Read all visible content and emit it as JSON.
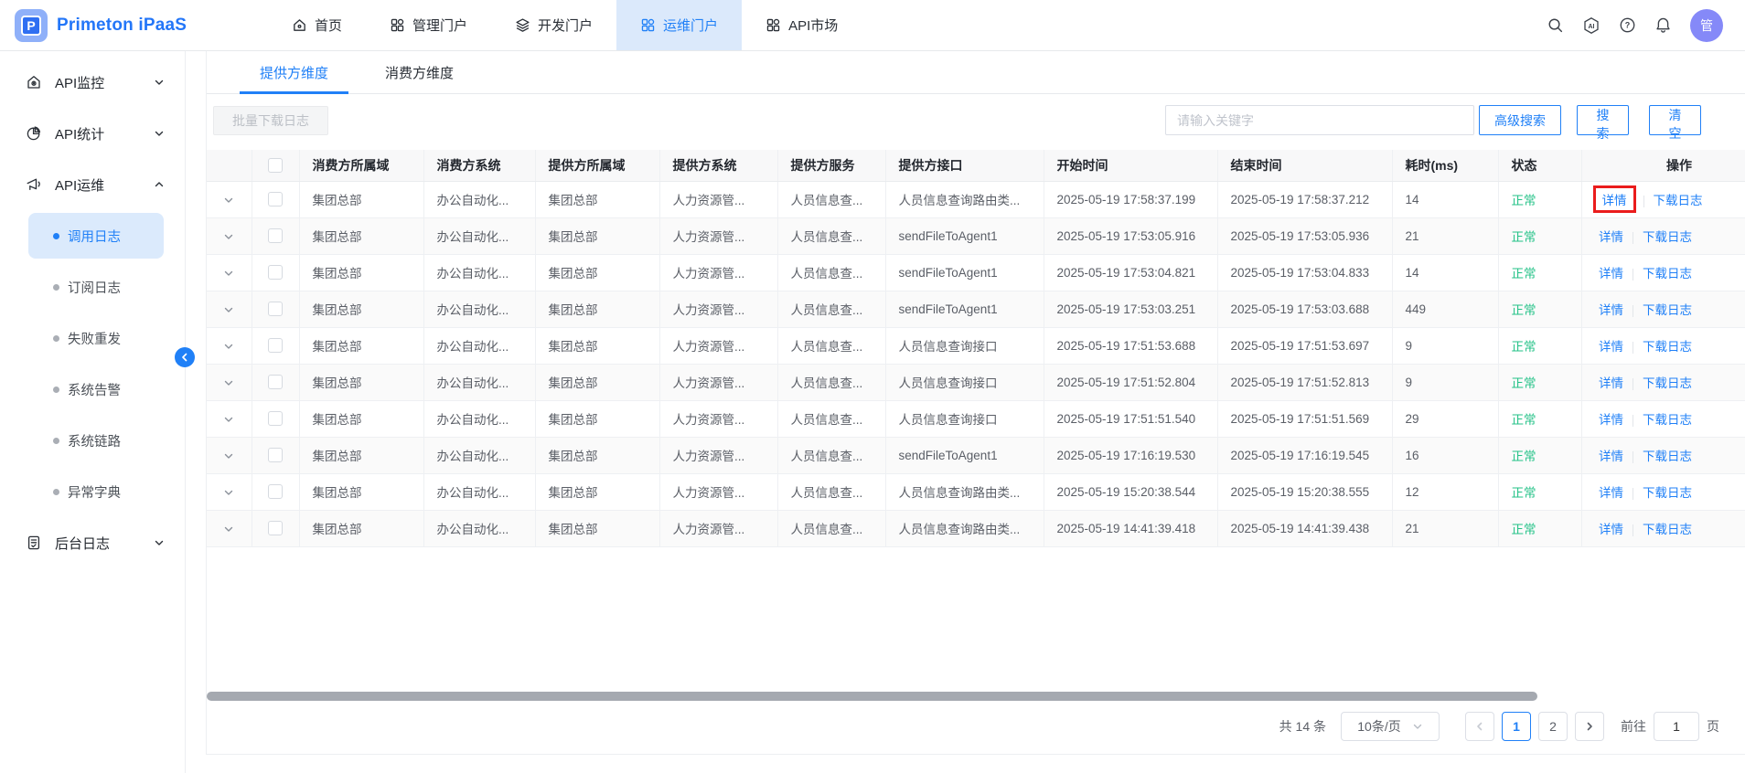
{
  "topbar": {
    "brand": "Primeton iPaaS",
    "logo_letter": "P",
    "nav": [
      {
        "id": "home",
        "label": "首页",
        "icon": "home-icon",
        "active": false
      },
      {
        "id": "admin-portal",
        "label": "管理门户",
        "icon": "grid-icon",
        "active": false
      },
      {
        "id": "dev-portal",
        "label": "开发门户",
        "icon": "layers-icon",
        "active": false
      },
      {
        "id": "ops-portal",
        "label": "运维门户",
        "icon": "grid-icon",
        "active": true
      },
      {
        "id": "api-market",
        "label": "API市场",
        "icon": "grid-icon",
        "active": false
      }
    ],
    "actions": [
      {
        "id": "search",
        "icon": "search-icon"
      },
      {
        "id": "ai-assistant",
        "icon": "ai-icon"
      },
      {
        "id": "help",
        "icon": "help-icon"
      },
      {
        "id": "notifications",
        "icon": "bell-icon"
      }
    ],
    "avatar_text": "管"
  },
  "sidebar": {
    "groups": [
      {
        "id": "api-monitor",
        "label": "API监控",
        "icon": "monitor-icon",
        "expanded": false,
        "children": []
      },
      {
        "id": "api-stats",
        "label": "API统计",
        "icon": "stats-icon",
        "expanded": false,
        "children": []
      },
      {
        "id": "api-ops",
        "label": "API运维",
        "icon": "ops-icon",
        "expanded": true,
        "children": [
          {
            "id": "call-log",
            "label": "调用日志",
            "active": true
          },
          {
            "id": "subscribe-log",
            "label": "订阅日志",
            "active": false
          },
          {
            "id": "fail-resend",
            "label": "失败重发",
            "active": false
          },
          {
            "id": "system-alert",
            "label": "系统告警",
            "active": false
          },
          {
            "id": "system-trace",
            "label": "系统链路",
            "active": false
          },
          {
            "id": "exception-dict",
            "label": "异常字典",
            "active": false
          }
        ]
      },
      {
        "id": "backend-log",
        "label": "后台日志",
        "icon": "doc-icon",
        "expanded": false,
        "children": []
      }
    ]
  },
  "tabs": [
    {
      "id": "provider-dim",
      "label": "提供方维度",
      "active": true
    },
    {
      "id": "consumer-dim",
      "label": "消费方维度",
      "active": false
    }
  ],
  "toolbar": {
    "batch_download_label": "批量下载日志",
    "search_placeholder": "请输入关键字",
    "advanced_search_label": "高级搜索",
    "search_label": "搜索",
    "clear_label": "清空"
  },
  "table": {
    "headers": [
      "消费方所属域",
      "消费方系统",
      "提供方所属域",
      "提供方系统",
      "提供方服务",
      "提供方接口",
      "开始时间",
      "结束时间",
      "耗时(ms)",
      "状态",
      "操作"
    ],
    "detail_label": "详情",
    "download_label": "下载日志",
    "rows": [
      {
        "consumer_domain": "集团总部",
        "consumer_system": "办公自动化...",
        "provider_domain": "集团总部",
        "provider_system": "人力资源管...",
        "provider_service": "人员信息查...",
        "provider_api": "人员信息查询路由类...",
        "start_time": "2025-05-19 17:58:37.199",
        "end_time": "2025-05-19 17:58:37.212",
        "duration": "14",
        "status": "正常",
        "highlighted": true
      },
      {
        "consumer_domain": "集团总部",
        "consumer_system": "办公自动化...",
        "provider_domain": "集团总部",
        "provider_system": "人力资源管...",
        "provider_service": "人员信息查...",
        "provider_api": "sendFileToAgent1",
        "start_time": "2025-05-19 17:53:05.916",
        "end_time": "2025-05-19 17:53:05.936",
        "duration": "21",
        "status": "正常",
        "highlighted": false
      },
      {
        "consumer_domain": "集团总部",
        "consumer_system": "办公自动化...",
        "provider_domain": "集团总部",
        "provider_system": "人力资源管...",
        "provider_service": "人员信息查...",
        "provider_api": "sendFileToAgent1",
        "start_time": "2025-05-19 17:53:04.821",
        "end_time": "2025-05-19 17:53:04.833",
        "duration": "14",
        "status": "正常",
        "highlighted": false
      },
      {
        "consumer_domain": "集团总部",
        "consumer_system": "办公自动化...",
        "provider_domain": "集团总部",
        "provider_system": "人力资源管...",
        "provider_service": "人员信息查...",
        "provider_api": "sendFileToAgent1",
        "start_time": "2025-05-19 17:53:03.251",
        "end_time": "2025-05-19 17:53:03.688",
        "duration": "449",
        "status": "正常",
        "highlighted": false
      },
      {
        "consumer_domain": "集团总部",
        "consumer_system": "办公自动化...",
        "provider_domain": "集团总部",
        "provider_system": "人力资源管...",
        "provider_service": "人员信息查...",
        "provider_api": "人员信息查询接口",
        "start_time": "2025-05-19 17:51:53.688",
        "end_time": "2025-05-19 17:51:53.697",
        "duration": "9",
        "status": "正常",
        "highlighted": false
      },
      {
        "consumer_domain": "集团总部",
        "consumer_system": "办公自动化...",
        "provider_domain": "集团总部",
        "provider_system": "人力资源管...",
        "provider_service": "人员信息查...",
        "provider_api": "人员信息查询接口",
        "start_time": "2025-05-19 17:51:52.804",
        "end_time": "2025-05-19 17:51:52.813",
        "duration": "9",
        "status": "正常",
        "highlighted": false
      },
      {
        "consumer_domain": "集团总部",
        "consumer_system": "办公自动化...",
        "provider_domain": "集团总部",
        "provider_system": "人力资源管...",
        "provider_service": "人员信息查...",
        "provider_api": "人员信息查询接口",
        "start_time": "2025-05-19 17:51:51.540",
        "end_time": "2025-05-19 17:51:51.569",
        "duration": "29",
        "status": "正常",
        "highlighted": false
      },
      {
        "consumer_domain": "集团总部",
        "consumer_system": "办公自动化...",
        "provider_domain": "集团总部",
        "provider_system": "人力资源管...",
        "provider_service": "人员信息查...",
        "provider_api": "sendFileToAgent1",
        "start_time": "2025-05-19 17:16:19.530",
        "end_time": "2025-05-19 17:16:19.545",
        "duration": "16",
        "status": "正常",
        "highlighted": false
      },
      {
        "consumer_domain": "集团总部",
        "consumer_system": "办公自动化...",
        "provider_domain": "集团总部",
        "provider_system": "人力资源管...",
        "provider_service": "人员信息查...",
        "provider_api": "人员信息查询路由类...",
        "start_time": "2025-05-19 15:20:38.544",
        "end_time": "2025-05-19 15:20:38.555",
        "duration": "12",
        "status": "正常",
        "highlighted": false
      },
      {
        "consumer_domain": "集团总部",
        "consumer_system": "办公自动化...",
        "provider_domain": "集团总部",
        "provider_system": "人力资源管...",
        "provider_service": "人员信息查...",
        "provider_api": "人员信息查询路由类...",
        "start_time": "2025-05-19 14:41:39.418",
        "end_time": "2025-05-19 14:41:39.438",
        "duration": "21",
        "status": "正常",
        "highlighted": false
      }
    ]
  },
  "pagination": {
    "total_text": "共 14 条",
    "page_size_label": "10条/页",
    "pages": [
      "1",
      "2"
    ],
    "current_page": "1",
    "goto_label": "前往",
    "goto_value": "1",
    "page_unit": "页"
  },
  "colors": {
    "accent_blue": "#2080f7",
    "nav_active_bg": "#dbe9fb",
    "status_green": "#23c287",
    "annotation_red": "#ea1c1c",
    "avatar_purple": "#8589f8"
  }
}
